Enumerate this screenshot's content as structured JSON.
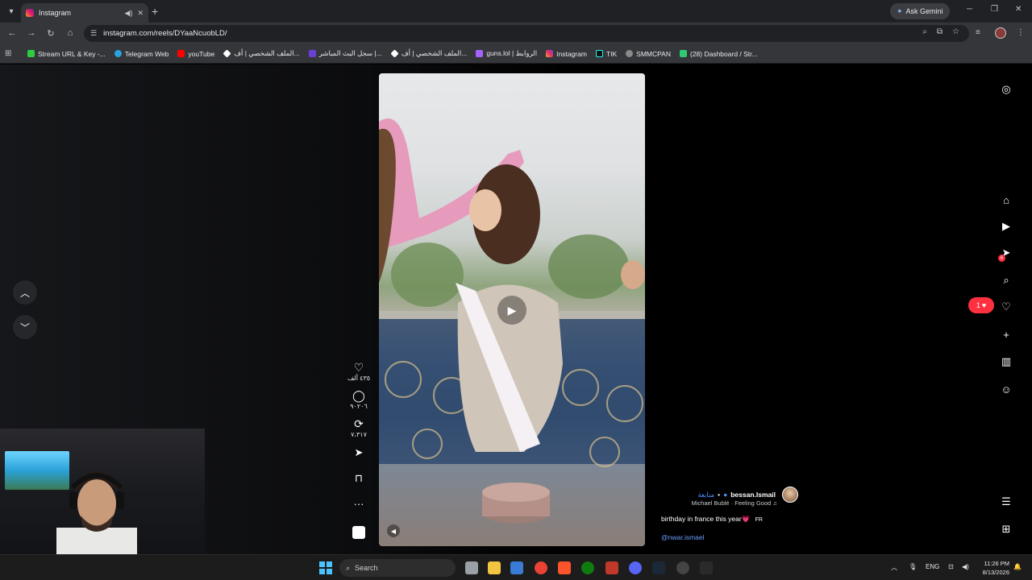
{
  "browser": {
    "tab_title": "Instagram",
    "ask_gemini": "Ask Gemini",
    "url": "instagram.com/reels/DYaaNcuobLD/"
  },
  "bookmarks": [
    {
      "label": "Stream URL & Key -...",
      "color": "#2ecc40"
    },
    {
      "label": "Telegram Web",
      "color": "#2aa3df"
    },
    {
      "label": "youTube",
      "color": "#ff0000"
    },
    {
      "label": "الملف الشخصي | أف...",
      "color": "#ffffff"
    },
    {
      "label": "سجل البث المباشر |...",
      "color": "#6b3fd6"
    },
    {
      "label": "الملف الشخصي | أف...",
      "color": "#ffffff"
    },
    {
      "label": "guns.lol | الروابط",
      "color": "#a463ff"
    },
    {
      "label": "Instagram",
      "color": "#e1306c"
    },
    {
      "label": "TIK",
      "color": "#111111"
    },
    {
      "label": "SMMCPAN",
      "color": "#8a8a8a"
    },
    {
      "label": "(28) Dashboard / Str...",
      "color": "#2ecc71"
    }
  ],
  "reel": {
    "likes": "٤٣٥ ألف",
    "comments": "٩٠٢٠٦",
    "reposts": "٧،٣١٧",
    "username": "bessan.Ismail",
    "follow": "متابعة",
    "music": "Michael Bublé · Feeling Good ♫",
    "caption": "birthday in france this year💗",
    "caption_lang": "FR",
    "mention": "@nwar.ismael"
  },
  "sidebar": {
    "notif_count": "1",
    "messages_badge": "6"
  },
  "taskbar": {
    "search": "Search",
    "lang": "ENG",
    "time": "11:26 PM",
    "date": "8/13/2026"
  }
}
